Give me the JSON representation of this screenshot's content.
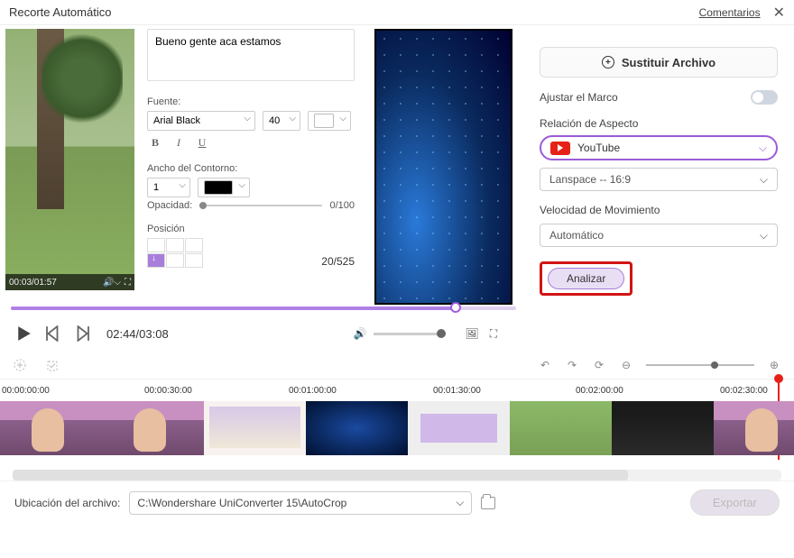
{
  "title": "Recorte Automático",
  "comments": "Comentarios",
  "preview": {
    "mini_time": "00:03/01:57"
  },
  "textPanel": {
    "content": "Bueno gente aca estamos",
    "font_label": "Fuente:",
    "font_family": "Arial Black",
    "font_size": "40",
    "outline_label": "Ancho del Contorno:",
    "outline_width": "1",
    "opacity_label": "Opacidad:",
    "opacity_value": "0/100",
    "position_label": "Posición",
    "position_value": "20/525"
  },
  "player": {
    "time": "02:44/03:08"
  },
  "side": {
    "replace": "Sustituir Archivo",
    "frame_adjust": "Ajustar el Marco",
    "aspect_label": "Relación de Aspecto",
    "aspect_source": "YouTube",
    "aspect_ratio": "Lanspace -- 16:9",
    "speed_label": "Velocidad de Movimiento",
    "speed_value": "Automático",
    "analyze": "Analizar"
  },
  "timeline": {
    "marks": [
      "00:00:00:00",
      "00:00:30:00",
      "00:01:00:00",
      "00:01:30:00",
      "00:02:00:00",
      "00:02:30:00"
    ]
  },
  "footer": {
    "label": "Ubicación del archivo:",
    "path": "C:\\Wondershare UniConverter 15\\AutoCrop",
    "export": "Exportar"
  }
}
